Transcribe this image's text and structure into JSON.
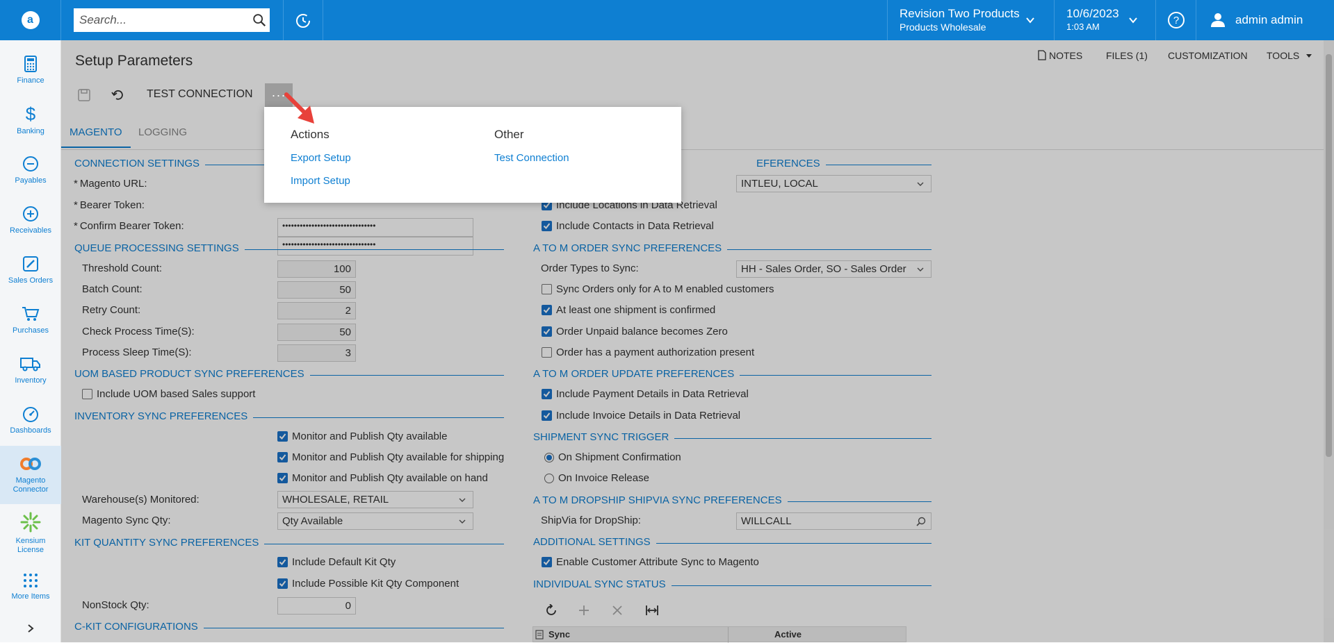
{
  "header": {
    "search_placeholder": "Search...",
    "company_name": "Revision Two Products",
    "company_branch": "Products Wholesale",
    "date": "10/6/2023",
    "time": "1:03 AM",
    "user_name": "admin admin"
  },
  "sidebar": {
    "items": [
      {
        "label": "Finance",
        "icon": "calculator-icon"
      },
      {
        "label": "Banking",
        "icon": "dollar-icon"
      },
      {
        "label": "Payables",
        "icon": "minus-circle-icon"
      },
      {
        "label": "Receivables",
        "icon": "plus-circle-icon"
      },
      {
        "label": "Sales Orders",
        "icon": "pencil-icon"
      },
      {
        "label": "Purchases",
        "icon": "cart-icon"
      },
      {
        "label": "Inventory",
        "icon": "truck-icon"
      },
      {
        "label": "Dashboards",
        "icon": "gauge-icon"
      },
      {
        "label": "Magento Connector",
        "icon": "magento-connector-icon"
      },
      {
        "label": "Kensium License",
        "icon": "kensium-icon"
      },
      {
        "label": "More Items",
        "icon": "grid-icon"
      }
    ],
    "active_index": 8
  },
  "page": {
    "title": "Setup Parameters",
    "links": {
      "notes": "NOTES",
      "files": "FILES (1)",
      "customization": "CUSTOMIZATION",
      "tools": "TOOLS"
    },
    "toolbar": {
      "test_connection": "TEST CONNECTION",
      "more": "···"
    },
    "tabs": [
      "MAGENTO",
      "LOGGING"
    ]
  },
  "dropdown": {
    "actions_header": "Actions",
    "other_header": "Other",
    "export_setup": "Export Setup",
    "import_setup": "Import Setup",
    "test_connection": "Test Connection"
  },
  "left": {
    "connection_settings": "CONNECTION SETTINGS",
    "magento_url_label": "Magento URL:",
    "bearer_token_label": "Bearer Token:",
    "bearer_token_value": "••••••••••••••••••••••••••••••••",
    "confirm_bearer_label": "Confirm Bearer Token:",
    "confirm_bearer_value": "••••••••••••••••••••••••••••••••",
    "queue_settings": "QUEUE PROCESSING SETTINGS",
    "threshold_label": "Threshold Count:",
    "threshold_value": "100",
    "batch_label": "Batch Count:",
    "batch_value": "50",
    "retry_label": "Retry Count:",
    "retry_value": "2",
    "check_label": "Check Process Time(S):",
    "check_value": "50",
    "sleep_label": "Process Sleep Time(S):",
    "sleep_value": "3",
    "uom_section": "UOM BASED PRODUCT SYNC PREFERENCES",
    "uom_checkbox": "Include UOM based Sales support",
    "inventory_section": "INVENTORY SYNC PREFERENCES",
    "monitor_qty": "Monitor and Publish Qty available",
    "monitor_shipping": "Monitor and Publish Qty available for shipping",
    "monitor_onhand": "Monitor and Publish Qty available on hand",
    "warehouse_label": "Warehouse(s) Monitored:",
    "warehouse_value": "WHOLESALE, RETAIL",
    "sync_qty_label": "Magento Sync Qty:",
    "sync_qty_value": "Qty Available",
    "kit_section": "KIT QUANTITY SYNC PREFERENCES",
    "default_kit": "Include Default Kit Qty",
    "possible_kit": "Include Possible Kit Qty Component",
    "nonstock_label": "NonStock Qty:",
    "nonstock_value": "0",
    "ckit_section": "C-KIT CONFIGURATIONS"
  },
  "right": {
    "pref_section_tail": "EFERENCES",
    "locations_value": "INTLEU, LOCAL",
    "include_locations": "Include Locations in Data Retrieval",
    "include_contacts": "Include Contacts in Data Retrieval",
    "order_sync_section": "A TO M ORDER SYNC PREFERENCES",
    "order_types_label": "Order Types to Sync:",
    "order_types_value": "HH - Sales Order, SO - Sales Order",
    "sync_enabled_only": "Sync Orders only for A to M enabled customers",
    "shipment_confirmed": "At least one shipment is confirmed",
    "unpaid_zero": "Order Unpaid balance becomes Zero",
    "payment_auth": "Order has a payment authorization present",
    "order_update_section": "A TO M ORDER UPDATE PREFERENCES",
    "include_payment": "Include Payment Details in Data Retrieval",
    "include_invoice": "Include Invoice Details in Data Retrieval",
    "shipment_trigger_section": "SHIPMENT SYNC TRIGGER",
    "on_shipment": "On Shipment Confirmation",
    "on_invoice": "On Invoice Release",
    "dropship_section": "A TO M DROPSHIP SHIPVIA SYNC PREFERENCES",
    "shipvia_label": "ShipVia for DropShip:",
    "shipvia_value": "WILLCALL",
    "additional_section": "ADDITIONAL SETTINGS",
    "enable_attr_sync": "Enable Customer Attribute Sync to Magento",
    "individual_section": "INDIVIDUAL SYNC STATUS",
    "grid_col_sync": "Sync",
    "grid_col_active": "Active"
  },
  "colors": {
    "brand": "#0e7fd2",
    "checkbox": "#1a73c9",
    "overlay": "rgba(0,0,0,0.22)",
    "arrow": "#e8413a"
  }
}
